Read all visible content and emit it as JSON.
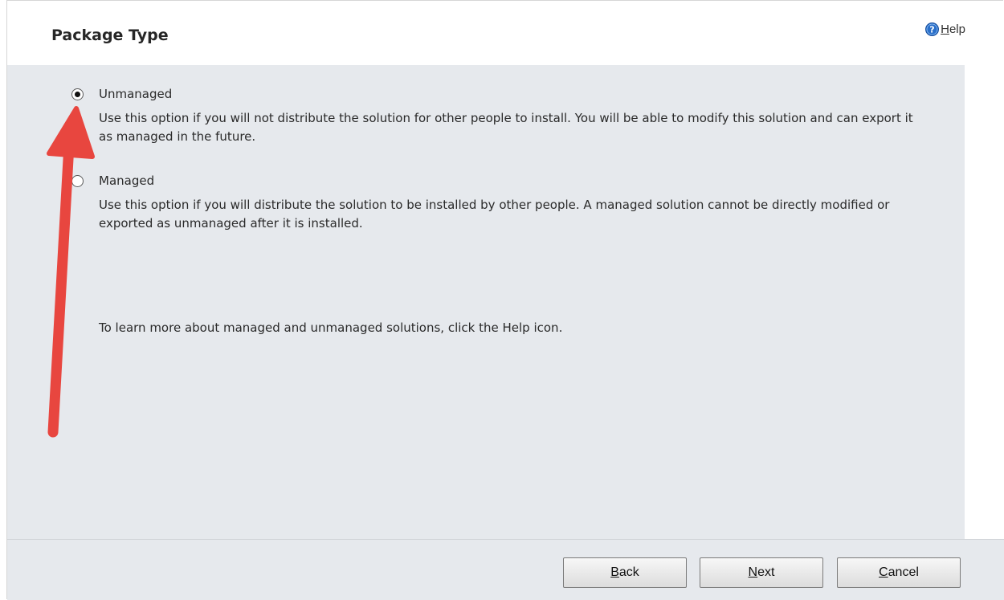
{
  "header": {
    "title": "Package Type",
    "help_label": "Help",
    "help_icon": "question-circle-icon"
  },
  "options": [
    {
      "label": "Unmanaged",
      "checked": true,
      "description": "Use this option if you will not distribute the solution for other people to install. You will be able to modify this solution and can export it as managed in the future."
    },
    {
      "label": "Managed",
      "checked": false,
      "description": "Use this option if you will distribute the solution to be installed by other people. A managed solution cannot be directly modified or exported as unmanaged after it is installed."
    }
  ],
  "learn_more": "To learn more about managed and unmanaged solutions, click the Help icon.",
  "footer": {
    "back_label": "Back",
    "next_label": "Next",
    "cancel_label": "Cancel"
  },
  "colors": {
    "panel_background": "#e6e9ed",
    "annotation_arrow": "#e8463f",
    "help_icon": "#2a6fc9"
  }
}
